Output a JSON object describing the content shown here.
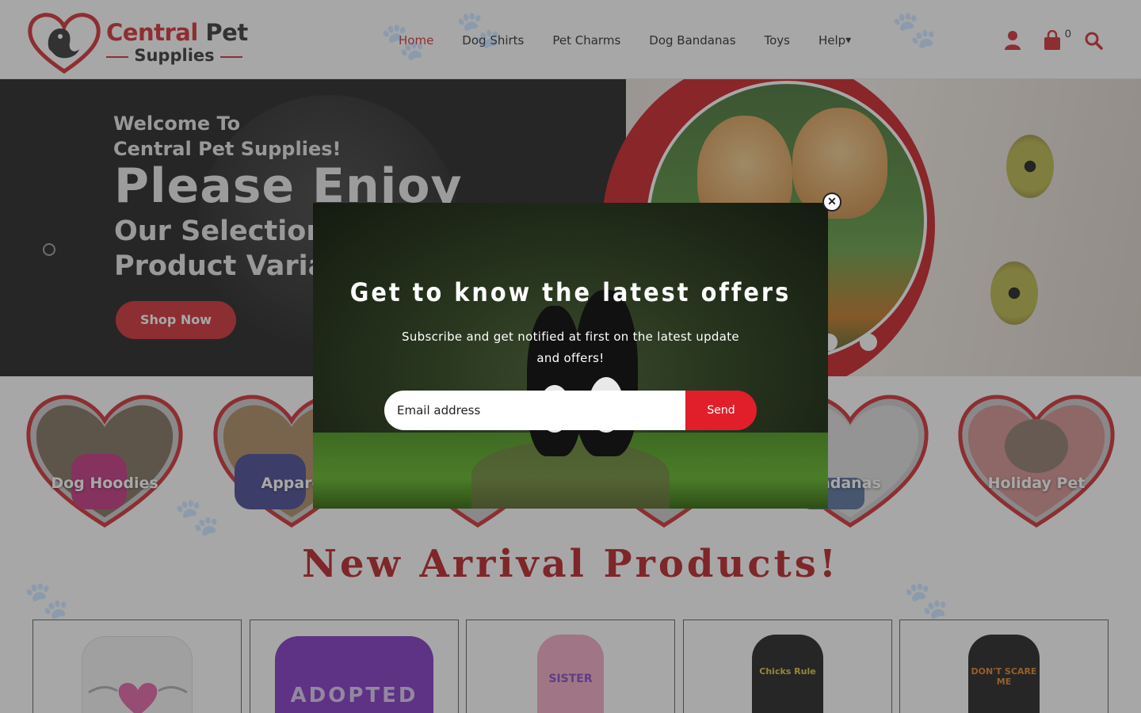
{
  "header": {
    "logo": {
      "line1_a": "Central",
      "line1_b": "Pet",
      "line2": "Supplies"
    },
    "nav": [
      {
        "label": "Home",
        "active": true
      },
      {
        "label": "Dog Shirts"
      },
      {
        "label": "Pet Charms"
      },
      {
        "label": "Dog Bandanas"
      },
      {
        "label": "Toys"
      },
      {
        "label": "Help"
      }
    ],
    "cart_count": "0",
    "icons": [
      "user-icon",
      "shopping-bag-icon",
      "search-icon"
    ]
  },
  "hero": {
    "welcome_line1": "Welcome To",
    "welcome_line2": "Central Pet Supplies!",
    "headline": "Please Enjoy",
    "sub_line1": "Our Selection o",
    "sub_line2": "Product Variat",
    "cta": "Shop Now"
  },
  "categories": [
    {
      "label": "Dog Hoodies"
    },
    {
      "label": "Appare"
    },
    {
      "label": ""
    },
    {
      "label": ""
    },
    {
      "label": "ndanas"
    },
    {
      "label": "Holiday Pet"
    }
  ],
  "arrivals": {
    "title": "New Arrival Products!",
    "products": [
      {
        "shirt_color": "#f5f5f5",
        "print": "",
        "print_color": "#d24a84"
      },
      {
        "shirt_color": "#7a2bbf",
        "print": "ADOPTED",
        "print_color": "#d9c7ee"
      },
      {
        "shirt_color": "#f2a5c4",
        "print": "SISTER",
        "print_color": "#7a3fc0"
      },
      {
        "shirt_color": "#151515",
        "print": "Chicks Rule",
        "print_color": "#e0c23a"
      },
      {
        "shirt_color": "#151515",
        "print": "DON'T SCARE ME",
        "print_color": "#e07a22"
      }
    ]
  },
  "popup": {
    "title": "Get to know the latest offers",
    "subtitle": "Subscribe and get notified at first on the latest update and offers!",
    "email_placeholder": "Email address",
    "send_label": "Send",
    "close_icon": "close-icon"
  },
  "colors": {
    "brand_red": "#d0232a",
    "send_red": "#e01f2b",
    "title_red": "#b5141b"
  }
}
